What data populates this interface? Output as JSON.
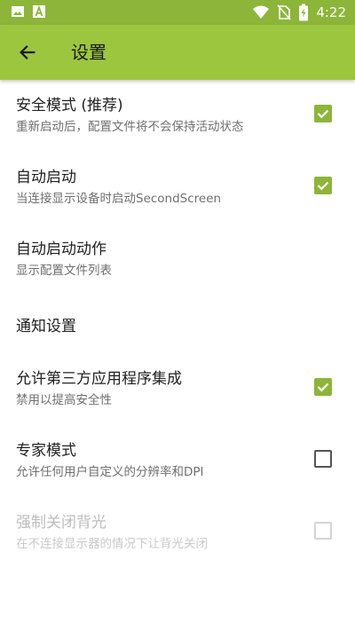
{
  "status_bar": {
    "time": "4:22",
    "icons": [
      "image-icon",
      "text-a-icon",
      "wifi-icon",
      "no-sim-icon",
      "battery-charging-icon"
    ]
  },
  "app_bar": {
    "title": "设置",
    "back_icon": "arrow-back-icon",
    "color": "#9dc63f"
  },
  "settings": [
    {
      "title": "安全模式 (推荐)",
      "summary": "重新启动后，配置文件将不会保持活动状态",
      "checked": true,
      "enabled": true
    },
    {
      "title": "自动启动",
      "summary": "当连接显示设备时启动SecondScreen",
      "checked": true,
      "enabled": true
    },
    {
      "title": "自动启动动作",
      "summary": "显示配置文件列表"
    },
    {
      "title": "通知设置"
    },
    {
      "title": "允许第三方应用程序集成",
      "summary": "禁用以提高安全性",
      "checked": true,
      "enabled": true
    },
    {
      "title": "专家模式",
      "summary": "允许任何用户自定义的分辨率和DPI",
      "checked": false,
      "enabled": true
    },
    {
      "title": "强制关闭背光",
      "summary": "在不连接显示器的情况下让背光关闭",
      "checked": false,
      "enabled": false
    }
  ],
  "colors": {
    "accent": "#8db53a",
    "status_bar": "#8db53a"
  }
}
